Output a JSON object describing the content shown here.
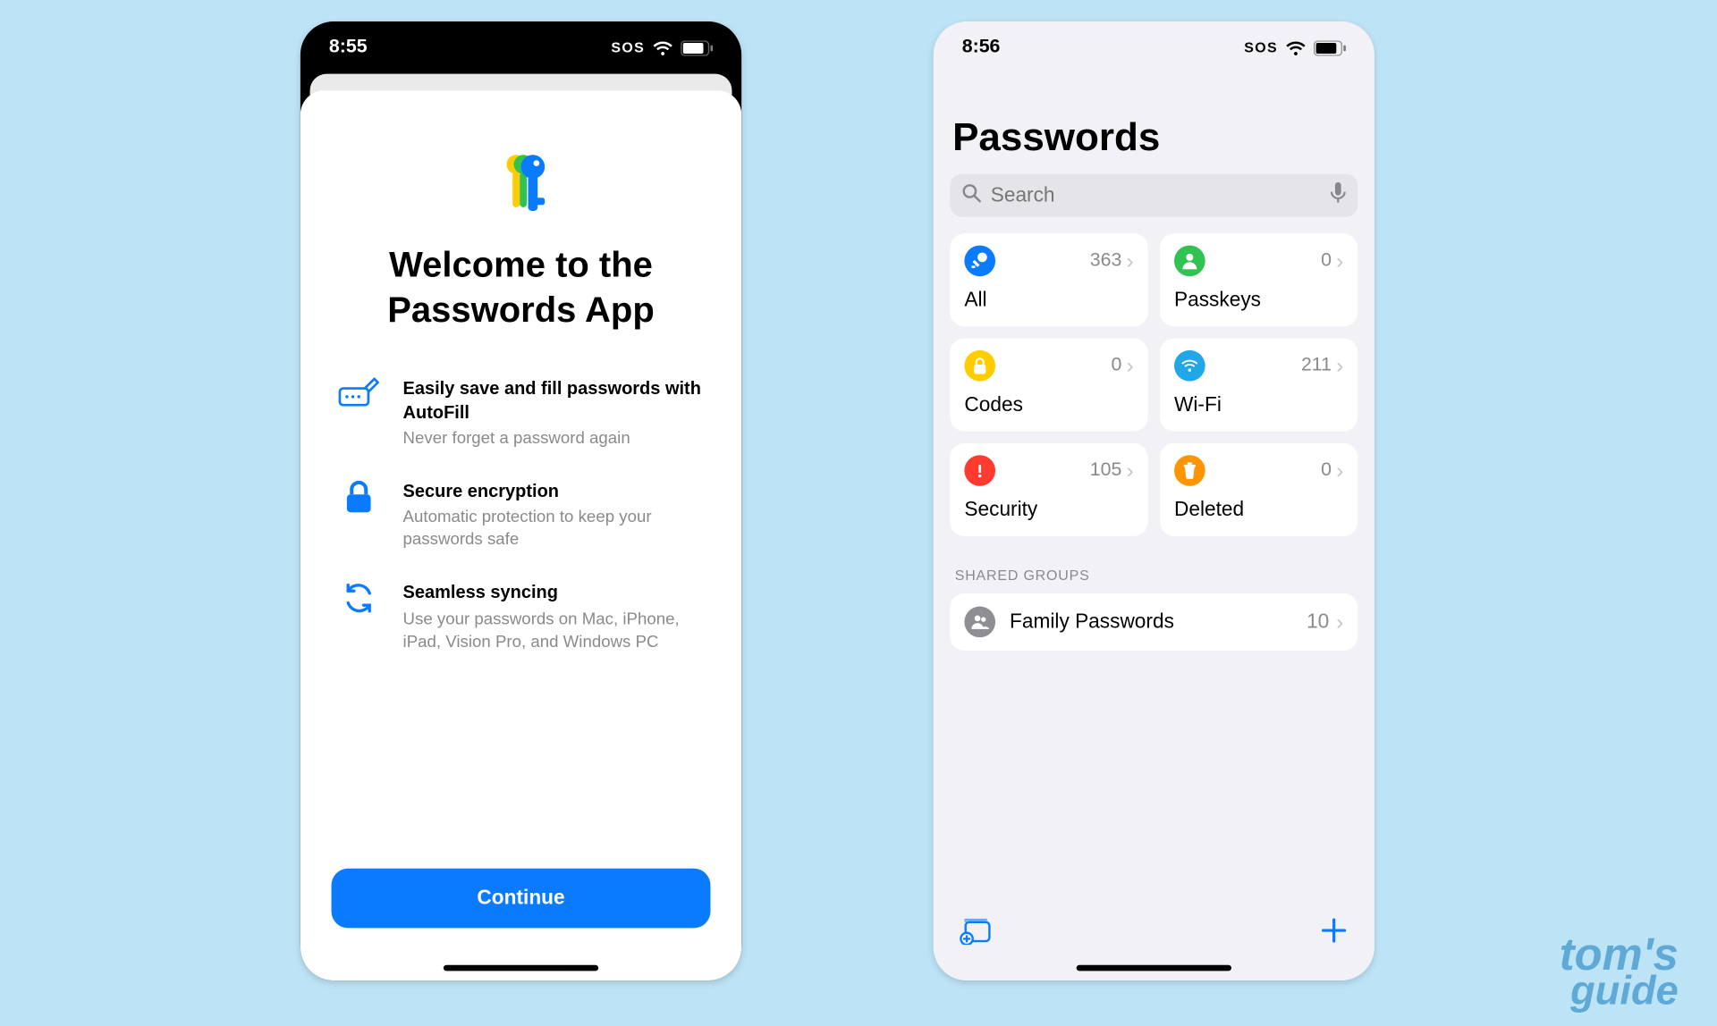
{
  "watermark": {
    "line1": "tom's",
    "line2": "guide"
  },
  "left": {
    "status": {
      "time": "8:55",
      "sos": "SOS"
    },
    "title_line1": "Welcome to the",
    "title_line2": "Passwords App",
    "features": [
      {
        "title": "Easily save and fill passwords with AutoFill",
        "sub": "Never forget a password again"
      },
      {
        "title": "Secure encryption",
        "sub": "Automatic protection to keep your passwords safe"
      },
      {
        "title": "Seamless syncing",
        "sub": "Use your passwords on Mac, iPhone, iPad, Vision Pro, and Windows PC"
      }
    ],
    "continue_label": "Continue"
  },
  "right": {
    "status": {
      "time": "8:56",
      "sos": "SOS"
    },
    "page_title": "Passwords",
    "search_placeholder": "Search",
    "cards": [
      {
        "label": "All",
        "count": "363",
        "color": "#0a7bff",
        "icon": "key"
      },
      {
        "label": "Passkeys",
        "count": "0",
        "color": "#30c352",
        "icon": "person"
      },
      {
        "label": "Codes",
        "count": "0",
        "color": "#ffcc00",
        "icon": "lockclock"
      },
      {
        "label": "Wi-Fi",
        "count": "211",
        "color": "#1fa7e8",
        "icon": "wifi"
      },
      {
        "label": "Security",
        "count": "105",
        "color": "#ff3b30",
        "icon": "alert"
      },
      {
        "label": "Deleted",
        "count": "0",
        "color": "#ff9500",
        "icon": "trash"
      }
    ],
    "shared_header": "SHARED GROUPS",
    "shared_groups": [
      {
        "label": "Family Passwords",
        "count": "10"
      }
    ]
  }
}
